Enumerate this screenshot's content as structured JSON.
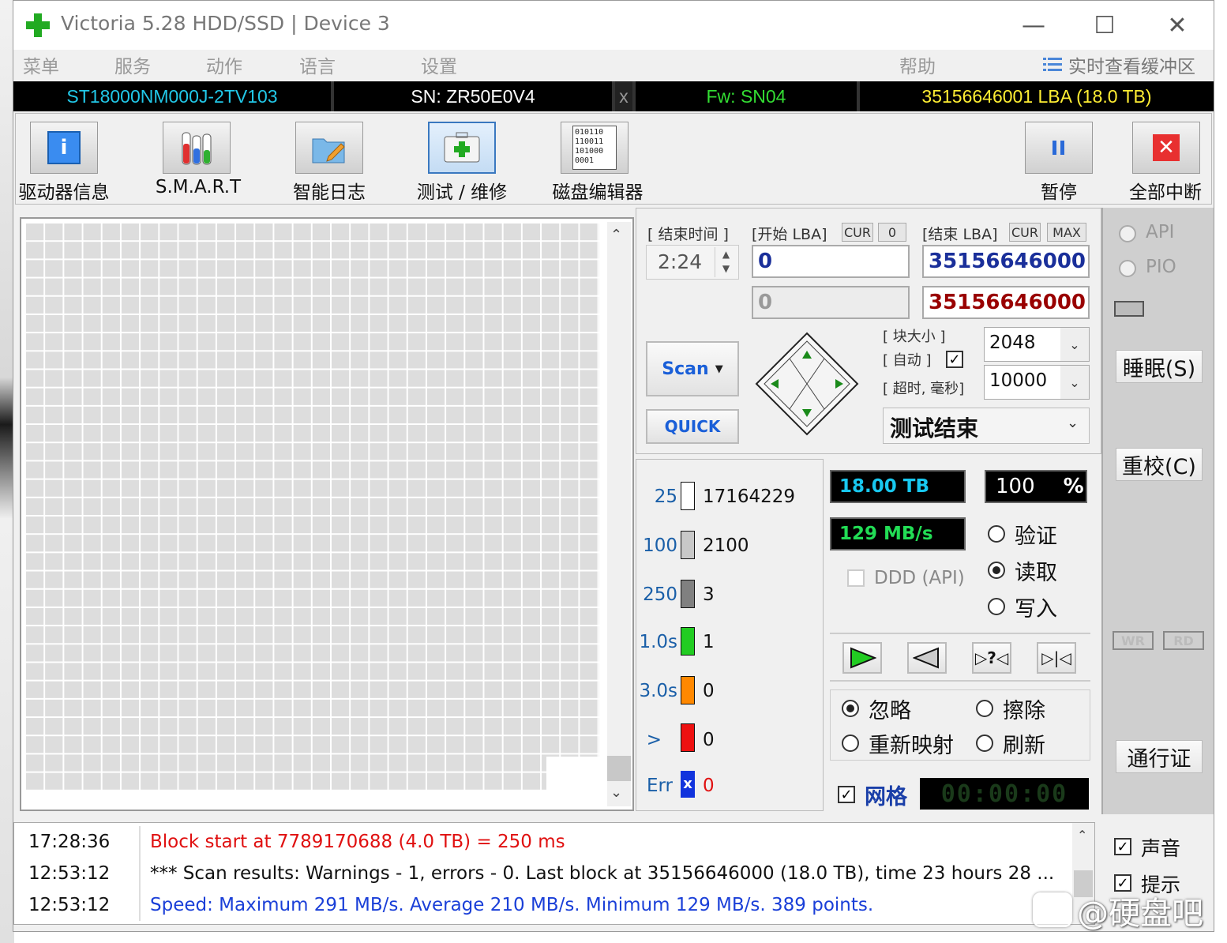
{
  "window": {
    "title": "Victoria 5.28 HDD/SSD | Device 3",
    "controls": {
      "minimize": "—",
      "maximize": "☐",
      "close": "✕"
    }
  },
  "menu": {
    "items": [
      "菜单",
      "服务",
      "动作",
      "语言",
      "设置",
      "帮助"
    ],
    "buffer_view": "实时查看缓冲区"
  },
  "device_info": {
    "model": "ST18000NM000J-2TV103",
    "serial": "SN: ZR50E0V4",
    "close_mark": "x",
    "firmware": "Fw: SN04",
    "capacity": "35156646001 LBA (18.0 TB)"
  },
  "toolbar": {
    "drive_info": "驱动器信息",
    "smart": "S.M.A.R.T",
    "smart_log": "智能日志",
    "test_repair": "测试 / 维修",
    "disk_editor": "磁盘编辑器",
    "disk_editor_glyph": "010110\n110011\n101000\n0001",
    "pause": "暂停",
    "abort_all": "全部中断"
  },
  "controls": {
    "end_time_label": "[ 结束时间 ]",
    "end_time_value": "2:24",
    "start_lba_label": "[开始 LBA]",
    "cur_label": "CUR",
    "start_cur_value": "0",
    "end_lba_label": "[结束 LBA]",
    "max_label": "MAX",
    "start_lba_value": "0",
    "end_lba_value": "35156646000",
    "start_lba_current": "0",
    "end_lba_current": "35156646000",
    "scan_button": "Scan",
    "quick_button": "QUICK",
    "block_size_label": "[ 块大小 ]",
    "auto_label": "[ 自动 ]",
    "timeout_label": "[ 超时, 毫秒]",
    "block_size_value": "2048",
    "timeout_value": "10000",
    "test_status": "测试结束"
  },
  "stats": [
    {
      "label": "25",
      "count": "17164229",
      "color": "#ffffff"
    },
    {
      "label": "100",
      "count": "2100",
      "color": "#c8c8c8"
    },
    {
      "label": "250",
      "count": "3",
      "color": "#808080"
    },
    {
      "label": "1.0s",
      "count": "1",
      "color": "#22cc22"
    },
    {
      "label": "3.0s",
      "count": "0",
      "color": "#ff8800"
    },
    {
      "label": ">",
      "count": "0",
      "color": "#ee1111"
    },
    {
      "label": "Err",
      "count": "0",
      "color": "#1133dd"
    }
  ],
  "progress": {
    "size": "18.00 TB",
    "percent": "100",
    "percent_unit": "%",
    "speed": "129 MB/s",
    "ddd_api": "DDD (API)",
    "modes": [
      "验证",
      "读取",
      "写入"
    ],
    "selected_mode": "读取"
  },
  "actions": {
    "options": [
      "忽略",
      "擦除",
      "重新映射",
      "刷新"
    ],
    "selected": "忽略",
    "grid_label": "网格",
    "timer": "00:00:00"
  },
  "side": {
    "api": "API",
    "pio": "PIO",
    "sleep": "睡眠(S)",
    "recalibrate": "重校(C)",
    "wr": "WR",
    "rd": "RD",
    "passport": "通行证"
  },
  "log": [
    {
      "time": "17:28:36",
      "text": "Block start at 7789170688 (4.0 TB)  = 250 ms",
      "color": "#e01010"
    },
    {
      "time": "12:53:12",
      "text": "*** Scan results: Warnings - 1, errors - 0. Last block at 35156646000 (18.0 TB), time 23 hours 28 ...",
      "color": "#111111"
    },
    {
      "time": "12:53:12",
      "text": "Speed: Maximum 291 MB/s. Average 210 MB/s. Minimum 129 MB/s. 389 points.",
      "color": "#1a3fd8"
    }
  ],
  "bottom_right": {
    "sound": "声音",
    "hints": "提示"
  },
  "watermark": "@硬盘吧",
  "colors": {
    "lcd_cyan": "#18c8f0",
    "lcd_green": "#22dd55",
    "model_cyan": "#22c8e8",
    "fw_green": "#33dd33",
    "capacity_yellow": "#ffee33",
    "lba_blue": "#1a2f9a",
    "lba_red": "#990000"
  }
}
